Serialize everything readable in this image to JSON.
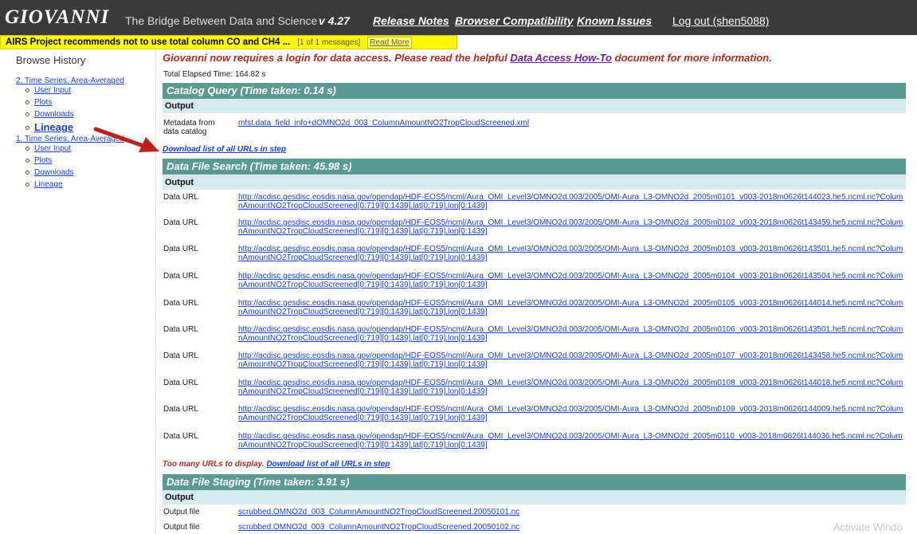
{
  "header": {
    "logo": "GIOVANNI",
    "tagline": "The Bridge Between Data and Science",
    "version": "v 4.27",
    "links": {
      "release_notes": "Release Notes",
      "browser_compat": "Browser Compatibility",
      "known_issues": "Known Issues"
    },
    "logout": "Log out (shen5088)"
  },
  "alert": {
    "text": "AIRS Project recommends not to use total column CO and CH4 ...",
    "count": "[1 of 1 messages]",
    "read_more": "Read More"
  },
  "sidebar": {
    "title": "Browse History",
    "groups": [
      {
        "label": "2. Time Series, Area-Averaged",
        "items": [
          "User Input",
          "Plots",
          "Downloads",
          "Lineage"
        ]
      },
      {
        "label": "1. Time Series, Area-Averaged",
        "items": [
          "User Input",
          "Plots",
          "Downloads",
          "Lineage"
        ]
      }
    ]
  },
  "main": {
    "notice_prefix": "Giovanni now requires a login for data access. Please read the helpful",
    "notice_link": "Data Access How-To",
    "notice_suffix": "document for more information.",
    "elapsed": "Total Elapsed Time: 164.82 s",
    "catalog": {
      "title": "Catalog Query (Time taken: 0.14 s)",
      "output_label": "Output",
      "meta_label_1": "Metadata from",
      "meta_label_2": "data catalog",
      "meta_link": "mfst.data_field_info+dOMNO2d_003_ColumnAmountNO2TropCloudScreened.xml"
    },
    "download_all_1": "Download list of all URLs in step",
    "search": {
      "title": "Data File Search (Time taken: 45.98 s)",
      "output_label": "Output",
      "row_label": "Data URL",
      "urls": [
        "http://acdisc.gesdisc.eosdis.nasa.gov/opendap/HDF-EOS5/ncml/Aura_OMI_Level3/OMNO2d.003/2005/OMI-Aura_L3-OMNO2d_2005m0101_v003-2018m0626t144023.he5.ncml.nc?ColumnAmountNO2TropCloudScreened[0:719][0:1439],lat[0:719],lon[0:1439]",
        "http://acdisc.gesdisc.eosdis.nasa.gov/opendap/HDF-EOS5/ncml/Aura_OMI_Level3/OMNO2d.003/2005/OMI-Aura_L3-OMNO2d_2005m0102_v003-2018m0626t143459.he5.ncml.nc?ColumnAmountNO2TropCloudScreened[0:719][0:1439],lat[0:719],lon[0:1439]",
        "http://acdisc.gesdisc.eosdis.nasa.gov/opendap/HDF-EOS5/ncml/Aura_OMI_Level3/OMNO2d.003/2005/OMI-Aura_L3-OMNO2d_2005m0103_v003-2018m0626t143501.he5.ncml.nc?ColumnAmountNO2TropCloudScreened[0:719][0:1439],lat[0:719],lon[0:1439]",
        "http://acdisc.gesdisc.eosdis.nasa.gov/opendap/HDF-EOS5/ncml/Aura_OMI_Level3/OMNO2d.003/2005/OMI-Aura_L3-OMNO2d_2005m0104_v003-2018m0626t143504.he5.ncml.nc?ColumnAmountNO2TropCloudScreened[0:719][0:1439],lat[0:719],lon[0:1439]",
        "http://acdisc.gesdisc.eosdis.nasa.gov/opendap/HDF-EOS5/ncml/Aura_OMI_Level3/OMNO2d.003/2005/OMI-Aura_L3-OMNO2d_2005m0105_v003-2018m0626t144014.he5.ncml.nc?ColumnAmountNO2TropCloudScreened[0:719][0:1439],lat[0:719],lon[0:1439]",
        "http://acdisc.gesdisc.eosdis.nasa.gov/opendap/HDF-EOS5/ncml/Aura_OMI_Level3/OMNO2d.003/2005/OMI-Aura_L3-OMNO2d_2005m0106_v003-2018m0626t143501.he5.ncml.nc?ColumnAmountNO2TropCloudScreened[0:719][0:1439],lat[0:719],lon[0:1439]",
        "http://acdisc.gesdisc.eosdis.nasa.gov/opendap/HDF-EOS5/ncml/Aura_OMI_Level3/OMNO2d.003/2005/OMI-Aura_L3-OMNO2d_2005m0107_v003-2018m0626t143458.he5.ncml.nc?ColumnAmountNO2TropCloudScreened[0:719][0:1439],lat[0:719],lon[0:1439]",
        "http://acdisc.gesdisc.eosdis.nasa.gov/opendap/HDF-EOS5/ncml/Aura_OMI_Level3/OMNO2d.003/2005/OMI-Aura_L3-OMNO2d_2005m0108_v003-2018m0626t144018.he5.ncml.nc?ColumnAmountNO2TropCloudScreened[0:719][0:1439],lat[0:719],lon[0:1439]",
        "http://acdisc.gesdisc.eosdis.nasa.gov/opendap/HDF-EOS5/ncml/Aura_OMI_Level3/OMNO2d.003/2005/OMI-Aura_L3-OMNO2d_2005m0109_v003-2018m0626t144009.he5.ncml.nc?ColumnAmountNO2TropCloudScreened[0:719][0:1439],lat[0:719],lon[0:1439]",
        "http://acdisc.gesdisc.eosdis.nasa.gov/opendap/HDF-EOS5/ncml/Aura_OMI_Level3/OMNO2d.003/2005/OMI-Aura_L3-OMNO2d_2005m0110_v003-2018m0626t144036.he5.ncml.nc?ColumnAmountNO2TropCloudScreened[0:719][0:1439],lat[0:719],lon[0:1439]"
      ]
    },
    "too_many": "Too many URLs to display.",
    "download_all_2": "Download list of all URLs in step",
    "staging": {
      "title": "Data File Staging (Time taken: 3.91 s)",
      "output_label": "Output",
      "row_label": "Output file",
      "files": [
        "scrubbed.OMNO2d_003_ColumnAmountNO2TropCloudScreened.20050101.nc",
        "scrubbed.OMNO2d_003_ColumnAmountNO2TropCloudScreened.20050102.nc"
      ]
    }
  },
  "watermark": "Activate Windo",
  "colors": {
    "header_bg": "#3a3a3a",
    "alert_bg": "#fff700",
    "section_head": "#5a9a91",
    "output_head": "#d4eaec",
    "link": "#1a3ee0",
    "notice": "#b22a22",
    "annotation_arrow": "#c0201a"
  }
}
